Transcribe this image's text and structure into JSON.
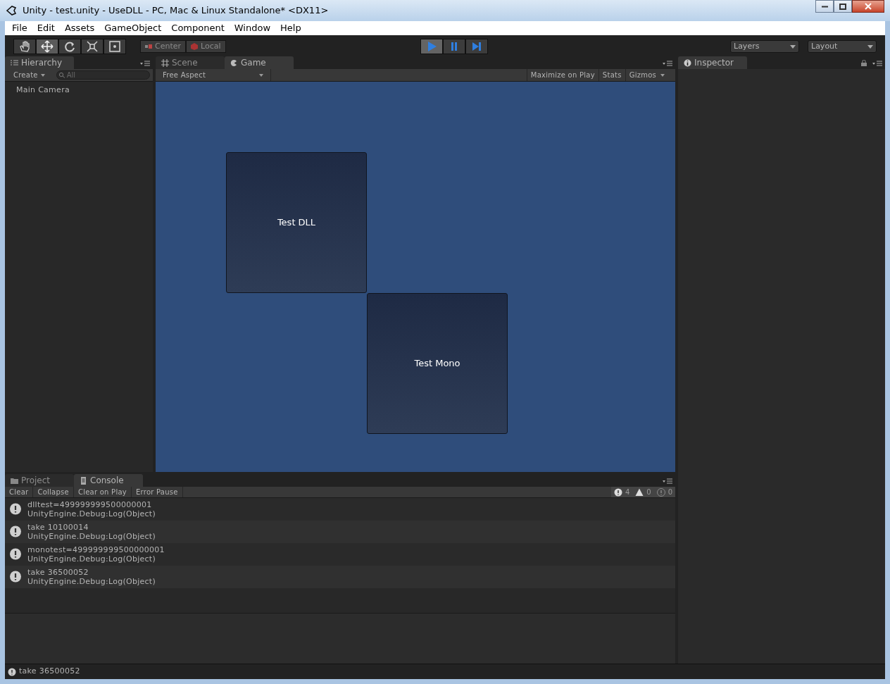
{
  "window": {
    "title": "Unity - test.unity - UseDLL - PC, Mac & Linux Standalone* <DX11>"
  },
  "menu": [
    "File",
    "Edit",
    "Assets",
    "GameObject",
    "Component",
    "Window",
    "Help"
  ],
  "toolbar": {
    "tools": [
      {
        "kind": "hand",
        "selected": false
      },
      {
        "kind": "move",
        "selected": true
      },
      {
        "kind": "rotate",
        "selected": false
      },
      {
        "kind": "scale",
        "selected": false
      },
      {
        "kind": "rect",
        "selected": false
      }
    ],
    "pivot": [
      "Center",
      "Local"
    ],
    "playback": [
      {
        "kind": "play",
        "selected": true
      },
      {
        "kind": "pause",
        "selected": false
      },
      {
        "kind": "step",
        "selected": false
      }
    ],
    "layers": "Layers",
    "layout": "Layout"
  },
  "hierarchy": {
    "tab": "Hierarchy",
    "create": "Create",
    "search": {
      "placeholder": "All"
    },
    "items": [
      "Main Camera"
    ]
  },
  "center_tabs": [
    {
      "label": "Scene",
      "kind": "scene",
      "selected": false
    },
    {
      "label": "Game",
      "kind": "game",
      "selected": true
    }
  ],
  "game": {
    "aspect": "Free Aspect",
    "options": [
      "Maximize on Play",
      "Stats",
      "Gizmos"
    ],
    "buttons": [
      "Test DLL",
      "Test Mono"
    ]
  },
  "inspector": {
    "tab": "Inspector"
  },
  "bottom_tabs": [
    {
      "label": "Project",
      "kind": "project",
      "selected": false
    },
    {
      "label": "Console",
      "kind": "console",
      "selected": true
    }
  ],
  "console": {
    "buttons": [
      "Clear",
      "Collapse",
      "Clear on Play",
      "Error Pause"
    ],
    "counts": [
      {
        "kind": "info",
        "count": "4"
      },
      {
        "kind": "warning",
        "count": "0"
      },
      {
        "kind": "error",
        "count": "0"
      }
    ],
    "entries": [
      {
        "message": "dlltest=499999999500000001",
        "trace": "UnityEngine.Debug:Log(Object)"
      },
      {
        "message": "take 10100014",
        "trace": "UnityEngine.Debug:Log(Object)"
      },
      {
        "message": "monotest=499999999500000001",
        "trace": "UnityEngine.Debug:Log(Object)"
      },
      {
        "message": "take 36500052",
        "trace": "UnityEngine.Debug:Log(Object)"
      }
    ]
  },
  "status_bar": {
    "message": "take 36500052"
  }
}
